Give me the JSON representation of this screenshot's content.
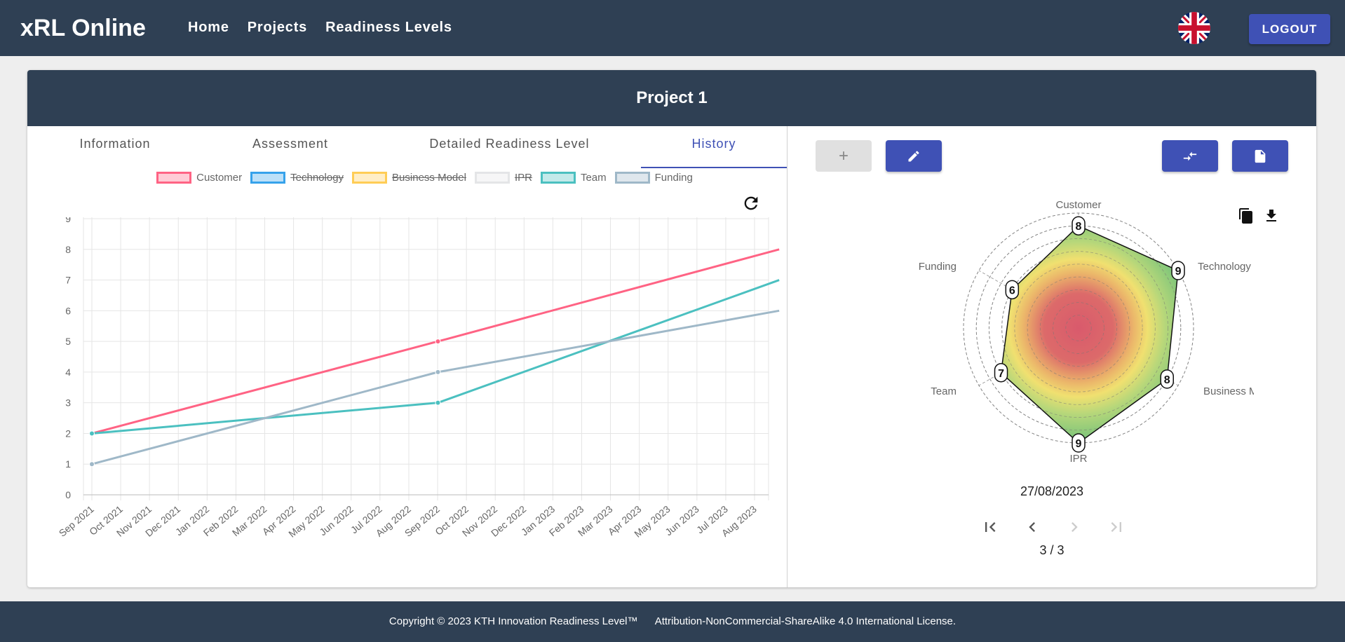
{
  "app": {
    "brand": "xRL Online",
    "logout_label": "LOGOUT"
  },
  "nav": {
    "items": [
      {
        "label": "Home"
      },
      {
        "label": "Projects"
      },
      {
        "label": "Readiness Levels"
      }
    ]
  },
  "project": {
    "title": "Project 1"
  },
  "tabs": [
    {
      "label": "Information",
      "active": false
    },
    {
      "label": "Assessment",
      "active": false
    },
    {
      "label": "Detailed Readiness Level",
      "active": false
    },
    {
      "label": "History",
      "active": true
    }
  ],
  "legend": [
    {
      "label": "Customer",
      "color": "#ff6384",
      "hidden": false
    },
    {
      "label": "Technology",
      "color": "#36a2eb",
      "hidden": true
    },
    {
      "label": "Business Model",
      "color": "#ffcd56",
      "hidden": true
    },
    {
      "label": "IPR",
      "color": "#e4e5e7",
      "hidden": true
    },
    {
      "label": "Team",
      "color": "#4bc0c0",
      "hidden": false
    },
    {
      "label": "Funding",
      "color": "#9fb8c8",
      "hidden": false
    }
  ],
  "chart_data": [
    {
      "type": "line",
      "x": [
        "Sep 2021",
        "Oct 2021",
        "Nov 2021",
        "Dec 2021",
        "Jan 2022",
        "Feb 2022",
        "Mar 2022",
        "Apr 2022",
        "May 2022",
        "Jun 2022",
        "Jul 2022",
        "Aug 2022",
        "Sep 2022",
        "Oct 2022",
        "Nov 2022",
        "Dec 2022",
        "Jan 2023",
        "Feb 2023",
        "Mar 2023",
        "Apr 2023",
        "May 2023",
        "Jun 2023",
        "Jul 2023",
        "Aug 2023"
      ],
      "ylim": [
        0,
        9
      ],
      "yticks": [
        "0",
        "1",
        "2",
        "3",
        "4",
        "5",
        "6",
        "7",
        "8",
        "9"
      ],
      "grid": true,
      "legend_position": "top",
      "series": [
        {
          "name": "Customer",
          "color": "#ff6384",
          "points": [
            {
              "x": "2021-09-01",
              "y": 2
            },
            {
              "x": "2022-09-01",
              "y": 5
            },
            {
              "x": "2023-08-27",
              "y": 8
            }
          ]
        },
        {
          "name": "Team",
          "color": "#4bc0c0",
          "points": [
            {
              "x": "2021-09-01",
              "y": 2
            },
            {
              "x": "2022-09-01",
              "y": 3
            },
            {
              "x": "2023-08-27",
              "y": 7
            }
          ]
        },
        {
          "name": "Funding",
          "color": "#9fb8c8",
          "points": [
            {
              "x": "2021-09-01",
              "y": 1
            },
            {
              "x": "2022-09-01",
              "y": 4
            },
            {
              "x": "2023-08-27",
              "y": 6
            }
          ]
        }
      ]
    },
    {
      "type": "radar",
      "categories": [
        "Customer",
        "Technology",
        "Business Model",
        "IPR",
        "Team",
        "Funding"
      ],
      "values": [
        8,
        9,
        8,
        9,
        7,
        6
      ],
      "rmax": 9
    }
  ],
  "radar_date": "27/08/2023",
  "pagination": {
    "text": "3 / 3"
  },
  "footer": {
    "copyright": "Copyright © 2023 KTH Innovation Readiness Level™",
    "license": "Attribution-NonCommercial-ShareAlike 4.0 International License."
  }
}
